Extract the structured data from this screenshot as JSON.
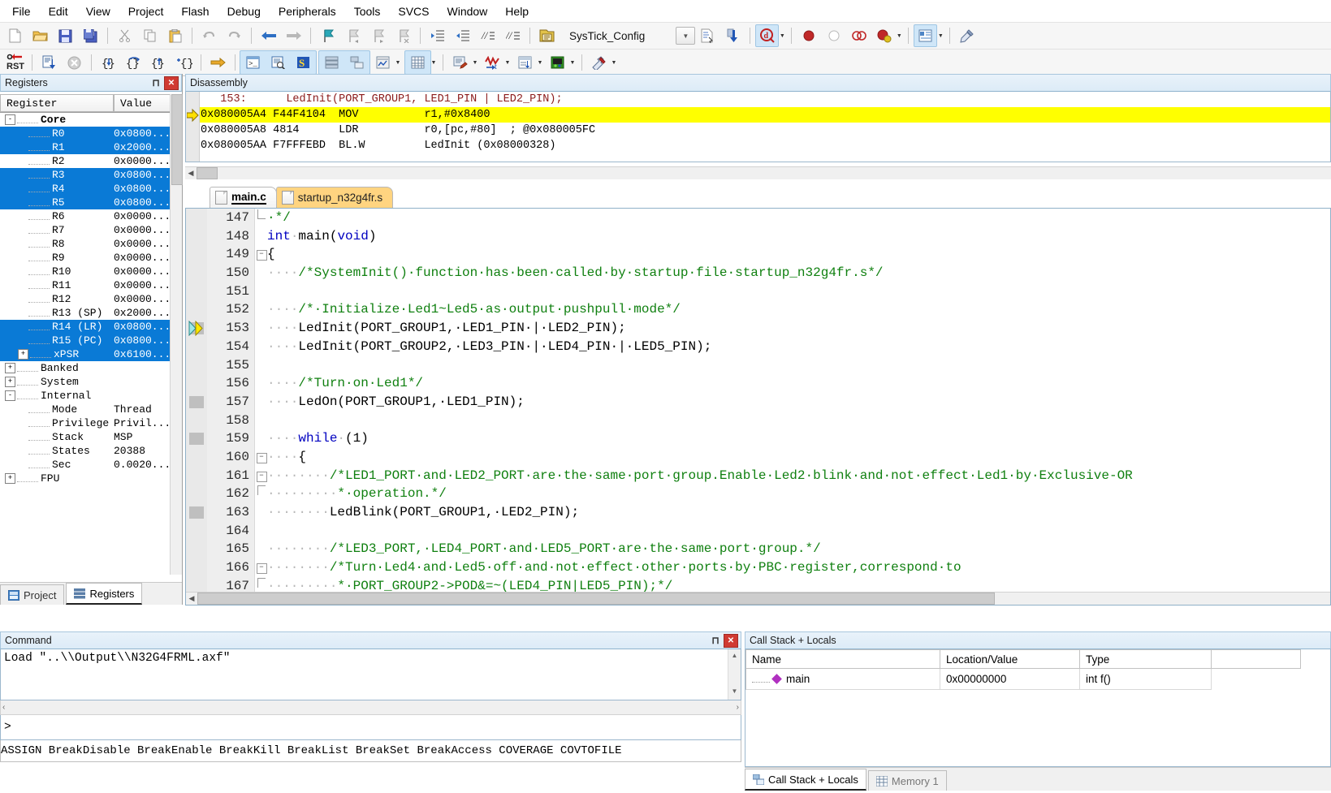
{
  "menu": {
    "items": [
      "File",
      "Edit",
      "View",
      "Project",
      "Flash",
      "Debug",
      "Peripherals",
      "Tools",
      "SVCS",
      "Window",
      "Help"
    ]
  },
  "toolbar1": {
    "icons": [
      "new-file-icon",
      "open-file-icon",
      "save-icon",
      "save-all-icon",
      "cut-icon",
      "copy-icon",
      "paste-icon",
      "undo-icon",
      "redo-icon",
      "navigate-back-icon",
      "navigate-forward-icon",
      "bookmark-toggle-icon",
      "bookmark-prev-icon",
      "bookmark-next-icon",
      "bookmark-clear-icon",
      "indent-icon",
      "outdent-icon",
      "comment-icon",
      "uncomment-icon"
    ],
    "project_name": "SysTick_Config",
    "target_dropdown": "target-combo-dropdown",
    "build_icons": [
      "target-options-icon",
      "download-icon"
    ],
    "debug_icons": [
      "start-stop-debug-icon",
      "insert-breakpoint-icon",
      "disable-breakpoint-icon",
      "kill-all-breakpoints-icon",
      "disable-all-breakpoints-icon",
      "manage-components-icon"
    ]
  },
  "toolbar2": {
    "reset_label": "RST",
    "icons": [
      "reset-cpu-icon",
      "run-icon",
      "stop-icon",
      "step-into-icon",
      "step-over-icon",
      "step-out-icon",
      "run-to-cursor-icon",
      "show-next-statement-icon",
      "command-window-icon",
      "disassembly-window-icon",
      "symbols-window-icon",
      "registers-window-icon",
      "call-stack-window-icon",
      "watch-window-icon",
      "memory-window-icon",
      "serial-window-icon",
      "analysis-window-icon",
      "trace-icon",
      "system-viewer-icon",
      "toolbox-icon"
    ]
  },
  "registers": {
    "title": "Registers",
    "columns": [
      "Register",
      "Value"
    ],
    "rows": [
      {
        "level": 1,
        "expander": "-",
        "label": "Core",
        "value": "",
        "bold": true,
        "highlight": false
      },
      {
        "level": 2,
        "expander": "",
        "label": "R0",
        "value": "0x0800...",
        "bold": false,
        "highlight": true
      },
      {
        "level": 2,
        "expander": "",
        "label": "R1",
        "value": "0x2000...",
        "bold": false,
        "highlight": true
      },
      {
        "level": 2,
        "expander": "",
        "label": "R2",
        "value": "0x0000...",
        "bold": false,
        "highlight": false
      },
      {
        "level": 2,
        "expander": "",
        "label": "R3",
        "value": "0x0800...",
        "bold": false,
        "highlight": true
      },
      {
        "level": 2,
        "expander": "",
        "label": "R4",
        "value": "0x0800...",
        "bold": false,
        "highlight": true
      },
      {
        "level": 2,
        "expander": "",
        "label": "R5",
        "value": "0x0800...",
        "bold": false,
        "highlight": true
      },
      {
        "level": 2,
        "expander": "",
        "label": "R6",
        "value": "0x0000...",
        "bold": false,
        "highlight": false
      },
      {
        "level": 2,
        "expander": "",
        "label": "R7",
        "value": "0x0000...",
        "bold": false,
        "highlight": false
      },
      {
        "level": 2,
        "expander": "",
        "label": "R8",
        "value": "0x0000...",
        "bold": false,
        "highlight": false
      },
      {
        "level": 2,
        "expander": "",
        "label": "R9",
        "value": "0x0000...",
        "bold": false,
        "highlight": false
      },
      {
        "level": 2,
        "expander": "",
        "label": "R10",
        "value": "0x0000...",
        "bold": false,
        "highlight": false
      },
      {
        "level": 2,
        "expander": "",
        "label": "R11",
        "value": "0x0000...",
        "bold": false,
        "highlight": false
      },
      {
        "level": 2,
        "expander": "",
        "label": "R12",
        "value": "0x0000...",
        "bold": false,
        "highlight": false
      },
      {
        "level": 2,
        "expander": "",
        "label": "R13 (SP)",
        "value": "0x2000...",
        "bold": false,
        "highlight": false
      },
      {
        "level": 2,
        "expander": "",
        "label": "R14 (LR)",
        "value": "0x0800...",
        "bold": false,
        "highlight": true
      },
      {
        "level": 2,
        "expander": "",
        "label": "R15 (PC)",
        "value": "0x0800...",
        "bold": false,
        "highlight": true
      },
      {
        "level": 2,
        "expander": "+",
        "label": "xPSR",
        "value": "0x6100...",
        "bold": false,
        "highlight": true
      },
      {
        "level": 1,
        "expander": "+",
        "label": "Banked",
        "value": "",
        "bold": false,
        "highlight": false
      },
      {
        "level": 1,
        "expander": "+",
        "label": "System",
        "value": "",
        "bold": false,
        "highlight": false
      },
      {
        "level": 1,
        "expander": "-",
        "label": "Internal",
        "value": "",
        "bold": false,
        "highlight": false
      },
      {
        "level": 2,
        "expander": "",
        "label": "Mode",
        "value": "Thread",
        "bold": false,
        "highlight": false
      },
      {
        "level": 2,
        "expander": "",
        "label": "Privilege",
        "value": "Privil...",
        "bold": false,
        "highlight": false
      },
      {
        "level": 2,
        "expander": "",
        "label": "Stack",
        "value": "MSP",
        "bold": false,
        "highlight": false
      },
      {
        "level": 2,
        "expander": "",
        "label": "States",
        "value": "20388",
        "bold": false,
        "highlight": false
      },
      {
        "level": 2,
        "expander": "",
        "label": "Sec",
        "value": "0.0020...",
        "bold": false,
        "highlight": false
      },
      {
        "level": 1,
        "expander": "+",
        "label": "FPU",
        "value": "",
        "bold": false,
        "highlight": false
      }
    ],
    "dock_tabs": [
      {
        "label": "Project",
        "icon": "project-icon",
        "active": false
      },
      {
        "label": "Registers",
        "icon": "registers-icon",
        "active": true
      }
    ]
  },
  "disassembly": {
    "title": "Disassembly",
    "lines": [
      {
        "kind": "source",
        "text": "   153:      LedInit(PORT_GROUP1, LED1_PIN | LED2_PIN); ",
        "current": false
      },
      {
        "kind": "asm",
        "text": "0x080005A4 F44F4104  MOV          r1,#0x8400",
        "current": true
      },
      {
        "kind": "asm",
        "text": "0x080005A8 4814      LDR          r0,[pc,#80]  ; @0x080005FC",
        "current": false
      },
      {
        "kind": "asm",
        "text": "0x080005AA F7FFFEBD  BL.W         LedInit (0x08000328)",
        "current": false
      }
    ]
  },
  "editor": {
    "tabs": [
      {
        "label": "main.c",
        "active": true
      },
      {
        "label": "startup_n32g4fr.s",
        "active": false
      }
    ],
    "first_line": 147,
    "lines": [
      {
        "num": 147,
        "fold": "L",
        "marker": false,
        "pc": false,
        "segments": [
          {
            "t": "cmt",
            "v": "·*/"
          }
        ]
      },
      {
        "num": 148,
        "fold": "",
        "marker": false,
        "pc": false,
        "segments": [
          {
            "t": "kw",
            "v": "int"
          },
          {
            "t": "ws",
            "v": "·"
          },
          {
            "t": "pl",
            "v": "main("
          },
          {
            "t": "kw",
            "v": "void"
          },
          {
            "t": "pl",
            "v": ")"
          }
        ]
      },
      {
        "num": 149,
        "fold": "-",
        "marker": false,
        "pc": false,
        "segments": [
          {
            "t": "pl",
            "v": "{"
          }
        ]
      },
      {
        "num": 150,
        "fold": "",
        "marker": false,
        "pc": false,
        "segments": [
          {
            "t": "ws",
            "v": "····"
          },
          {
            "t": "cmt",
            "v": "/*SystemInit()·function·has·been·called·by·startup·file·startup_n32g4fr.s*/"
          }
        ]
      },
      {
        "num": 151,
        "fold": "",
        "marker": false,
        "pc": false,
        "segments": []
      },
      {
        "num": 152,
        "fold": "",
        "marker": false,
        "pc": false,
        "segments": [
          {
            "t": "ws",
            "v": "····"
          },
          {
            "t": "cmt",
            "v": "/*·Initialize·Led1~Led5·as·output·pushpull·mode*/"
          }
        ]
      },
      {
        "num": 153,
        "fold": "",
        "marker": true,
        "pc": true,
        "segments": [
          {
            "t": "ws",
            "v": "····"
          },
          {
            "t": "pl",
            "v": "LedInit(PORT_GROUP1,·LED1_PIN·|·LED2_PIN);"
          }
        ]
      },
      {
        "num": 154,
        "fold": "",
        "marker": false,
        "pc": false,
        "segments": [
          {
            "t": "ws",
            "v": "····"
          },
          {
            "t": "pl",
            "v": "LedInit(PORT_GROUP2,·LED3_PIN·|·LED4_PIN·|·LED5_PIN);"
          }
        ]
      },
      {
        "num": 155,
        "fold": "",
        "marker": false,
        "pc": false,
        "segments": []
      },
      {
        "num": 156,
        "fold": "",
        "marker": false,
        "pc": false,
        "segments": [
          {
            "t": "ws",
            "v": "····"
          },
          {
            "t": "cmt",
            "v": "/*Turn·on·Led1*/"
          }
        ]
      },
      {
        "num": 157,
        "fold": "",
        "marker": true,
        "pc": false,
        "segments": [
          {
            "t": "ws",
            "v": "····"
          },
          {
            "t": "pl",
            "v": "LedOn(PORT_GROUP1,·LED1_PIN);"
          }
        ]
      },
      {
        "num": 158,
        "fold": "",
        "marker": false,
        "pc": false,
        "segments": []
      },
      {
        "num": 159,
        "fold": "",
        "marker": true,
        "pc": false,
        "segments": [
          {
            "t": "ws",
            "v": "····"
          },
          {
            "t": "kw",
            "v": "while"
          },
          {
            "t": "ws",
            "v": "·"
          },
          {
            "t": "pl",
            "v": "(1)"
          }
        ]
      },
      {
        "num": 160,
        "fold": "-",
        "marker": false,
        "pc": false,
        "segments": [
          {
            "t": "ws",
            "v": "····"
          },
          {
            "t": "pl",
            "v": "{"
          }
        ]
      },
      {
        "num": 161,
        "fold": "-",
        "marker": false,
        "pc": false,
        "segments": [
          {
            "t": "ws",
            "v": "········"
          },
          {
            "t": "cmt",
            "v": "/*LED1_PORT·and·LED2_PORT·are·the·same·port·group.Enable·Led2·blink·and·not·effect·Led1·by·Exclusive-OR"
          }
        ]
      },
      {
        "num": 162,
        "fold": "|",
        "marker": false,
        "pc": false,
        "segments": [
          {
            "t": "ws",
            "v": "·········"
          },
          {
            "t": "cmt",
            "v": "*·operation.*/"
          }
        ]
      },
      {
        "num": 163,
        "fold": "",
        "marker": true,
        "pc": false,
        "segments": [
          {
            "t": "ws",
            "v": "········"
          },
          {
            "t": "pl",
            "v": "LedBlink(PORT_GROUP1,·LED2_PIN);"
          }
        ]
      },
      {
        "num": 164,
        "fold": "",
        "marker": false,
        "pc": false,
        "segments": []
      },
      {
        "num": 165,
        "fold": "",
        "marker": false,
        "pc": false,
        "segments": [
          {
            "t": "ws",
            "v": "········"
          },
          {
            "t": "cmt",
            "v": "/*LED3_PORT,·LED4_PORT·and·LED5_PORT·are·the·same·port·group.*/"
          }
        ]
      },
      {
        "num": 166,
        "fold": "-",
        "marker": false,
        "pc": false,
        "segments": [
          {
            "t": "ws",
            "v": "········"
          },
          {
            "t": "cmt",
            "v": "/*Turn·Led4·and·Led5·off·and·not·effect·other·ports·by·PBC·register,correspond·to"
          }
        ]
      },
      {
        "num": 167,
        "fold": "|",
        "marker": false,
        "pc": false,
        "segments": [
          {
            "t": "ws",
            "v": "·········"
          },
          {
            "t": "cmt",
            "v": "*·PORT_GROUP2->POD&=~(LED4_PIN|LED5_PIN);*/"
          }
        ]
      }
    ]
  },
  "command": {
    "title": "Command",
    "output": "Load \"..\\\\Output\\\\N32G4FRML.axf\"",
    "prompt": ">",
    "input_value": "",
    "status": "ASSIGN BreakDisable BreakEnable BreakKill BreakList BreakSet BreakAccess COVERAGE COVTOFILE"
  },
  "callstack": {
    "title": "Call Stack + Locals",
    "columns": [
      "Name",
      "Location/Value",
      "Type",
      ""
    ],
    "rows": [
      {
        "name": "main",
        "location": "0x00000000",
        "type": "int f()"
      }
    ],
    "tabs": [
      {
        "label": "Call Stack + Locals",
        "icon": "call-stack-icon",
        "active": true
      },
      {
        "label": "Memory 1",
        "icon": "memory-icon",
        "active": false
      }
    ]
  },
  "colors": {
    "highlight_blue": "#0a7ad6",
    "current_line_yellow": "#ffff00",
    "comment_green": "#108010",
    "keyword_blue": "#0000c0",
    "disasm_source_red": "#8b1a1a",
    "panel_title_blue": "#dcebf7",
    "close_red": "#d03a32",
    "inactive_tab_orange": "#ffd480"
  }
}
